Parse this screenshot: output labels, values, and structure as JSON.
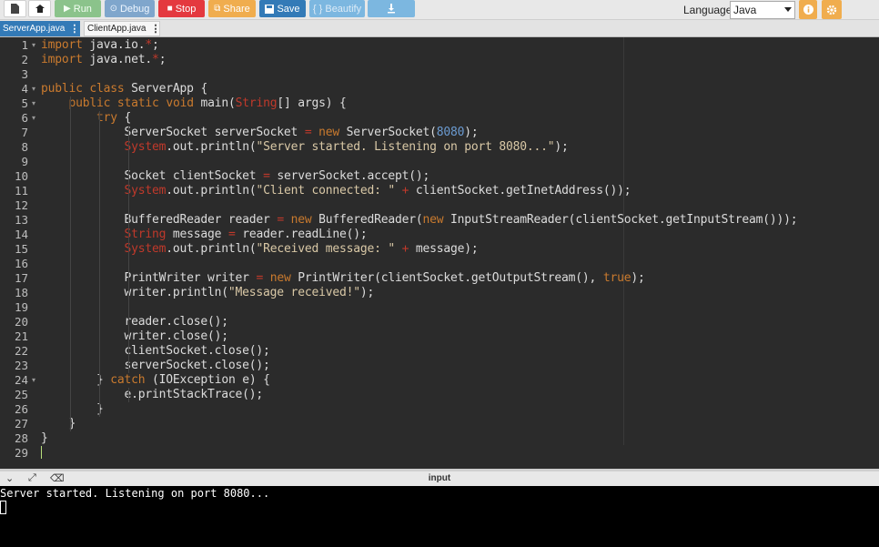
{
  "toolbar": {
    "run_label": "Run",
    "debug_label": "Debug",
    "stop_label": "Stop",
    "share_label": "Share",
    "save_label": "Save",
    "beautify_label": "{ } Beautify",
    "language_label": "Language",
    "language_value": "Java",
    "icons": [
      "file-icon",
      "open-icon",
      "play-icon",
      "debug-icon",
      "stop-icon",
      "share-icon",
      "save-icon",
      "download-icon",
      "info-icon",
      "gear-icon"
    ]
  },
  "tabs": [
    {
      "label": "ServerApp.java",
      "active": true
    },
    {
      "label": "ClientApp.java",
      "active": false
    }
  ],
  "editor": {
    "lines": [
      "import java.io.*;",
      "import java.net.*;",
      "",
      "public class ServerApp {",
      "    public static void main(String[] args) {",
      "        try {",
      "            ServerSocket serverSocket = new ServerSocket(8080);",
      "            System.out.println(\"Server started. Listening on port 8080...\");",
      "",
      "            Socket clientSocket = serverSocket.accept();",
      "            System.out.println(\"Client connected: \" + clientSocket.getInetAddress());",
      "",
      "            BufferedReader reader = new BufferedReader(new InputStreamReader(clientSocket.getInputStream()));",
      "            String message = reader.readLine();",
      "            System.out.println(\"Received message: \" + message);",
      "",
      "            PrintWriter writer = new PrintWriter(clientSocket.getOutputStream(), true);",
      "            writer.println(\"Message received!\");",
      "",
      "            reader.close();",
      "            writer.close();",
      "            clientSocket.close();",
      "            serverSocket.close();",
      "        } catch (IOException e) {",
      "            e.printStackTrace();",
      "        }",
      "    }",
      "}",
      ""
    ],
    "folded_lines": [
      1,
      4,
      5,
      6,
      24
    ]
  },
  "console": {
    "title": "input",
    "output": "Server started. Listening on port 8080..."
  },
  "colors": {
    "editor_bg": "#2b2b2b",
    "keyword": "#c97a2e",
    "type": "#c0392b",
    "string": "#d9c8a6",
    "number": "#6b9bd1",
    "accent": "#337ab7"
  }
}
